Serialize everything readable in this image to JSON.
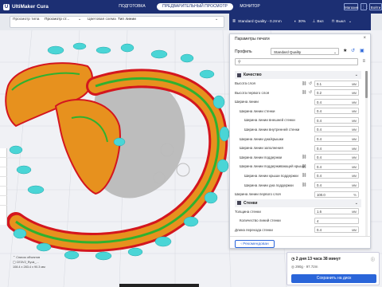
{
  "app": {
    "title": "UltiMaker Cura"
  },
  "stages": [
    {
      "label": "ПОДГОТОВКА",
      "active": false
    },
    {
      "label": "ПРЕДВАРИТЕЛЬНЫЙ ПРОСМОТР",
      "active": true
    },
    {
      "label": "МОНИТОР",
      "active": false
    }
  ],
  "topbar": {
    "marketplace": "Магазин",
    "signin": "Войти"
  },
  "header2": {
    "view_type_label": "Просмотр типа",
    "view_type_value": "Просмотр ст...",
    "color_scheme_label": "Цветовая схема",
    "color_scheme_value": "Тип линии"
  },
  "print_status": {
    "quality": "Standard Quality - 0.2mm",
    "infill": "30%",
    "support": "Вкл",
    "adhesion": "Выкл"
  },
  "panel": {
    "title": "Параметры печати",
    "profile_label": "Профиль",
    "profile_value": "Standard Quality",
    "search_placeholder": ""
  },
  "categories": [
    {
      "name": "Качество",
      "rows": [
        {
          "label": "Высота слоя",
          "value": "0.1",
          "unit": "мм",
          "indent": 0,
          "icons": [
            "link",
            "reset"
          ]
        },
        {
          "label": "Высота первого слоя",
          "value": "0.2",
          "unit": "мм",
          "indent": 0,
          "icons": [
            "link",
            "reset"
          ]
        },
        {
          "label": "Ширина линии",
          "value": "0.4",
          "unit": "мм",
          "indent": 0,
          "icons": []
        },
        {
          "label": "Ширина линии стенки",
          "value": "0.4",
          "unit": "мм",
          "indent": 1,
          "icons": []
        },
        {
          "label": "Ширина линии внешней стенки",
          "value": "0.4",
          "unit": "мм",
          "indent": 2,
          "icons": []
        },
        {
          "label": "Ширина линии внутренней стенки",
          "value": "0.4",
          "unit": "мм",
          "indent": 2,
          "icons": []
        },
        {
          "label": "Ширина линии дна/крышки",
          "value": "0.4",
          "unit": "мм",
          "indent": 1,
          "icons": []
        },
        {
          "label": "Ширина линии заполнения",
          "value": "0.4",
          "unit": "мм",
          "indent": 1,
          "icons": []
        },
        {
          "label": "Ширина линии поддержки",
          "value": "0.4",
          "unit": "мм",
          "indent": 1,
          "icons": [
            "link"
          ]
        },
        {
          "label": "Ширина линии поддерживающей крыши",
          "value": "0.4",
          "unit": "мм",
          "indent": 1,
          "icons": [
            "link"
          ]
        },
        {
          "label": "Ширина линии крыши поддержки",
          "value": "0.4",
          "unit": "мм",
          "indent": 2,
          "icons": [
            "link"
          ]
        },
        {
          "label": "Ширина линии дна поддержки",
          "value": "0.4",
          "unit": "мм",
          "indent": 2,
          "icons": [
            "link"
          ]
        },
        {
          "label": "Ширина линии первого слоя",
          "value": "100.0",
          "unit": "%",
          "indent": 0,
          "icons": []
        }
      ]
    },
    {
      "name": "Стенки",
      "rows": [
        {
          "label": "Толщина стенки",
          "value": "1.6",
          "unit": "мм",
          "indent": 0,
          "icons": []
        },
        {
          "label": "Количество линий стенки",
          "value": "4",
          "unit": "",
          "indent": 1,
          "icons": []
        },
        {
          "label": "Длина перехода стенки",
          "value": "0.4",
          "unit": "мм",
          "indent": 0,
          "icons": []
        }
      ]
    }
  ],
  "footer": {
    "recommended": "Рекомендован"
  },
  "object_info": {
    "list_label": "Список объектов",
    "file_name": "CE3V2_Ryuk_...",
    "dimensions": "108.4 x 283.4 x 90.3 мм"
  },
  "estimate": {
    "time": "2 дня 13 часа 38 минут",
    "material": "290g · 97.72m",
    "save_button": "Сохранить на диск"
  },
  "colors": {
    "topbar": "#1c2f73",
    "accent": "#2a65d9",
    "infill_orange": "#e7911e",
    "wall_red": "#d4161e",
    "skin_green": "#2fb12f",
    "support_cyan": "#4ad5d6",
    "travel_gray": "#9a9a9a"
  }
}
